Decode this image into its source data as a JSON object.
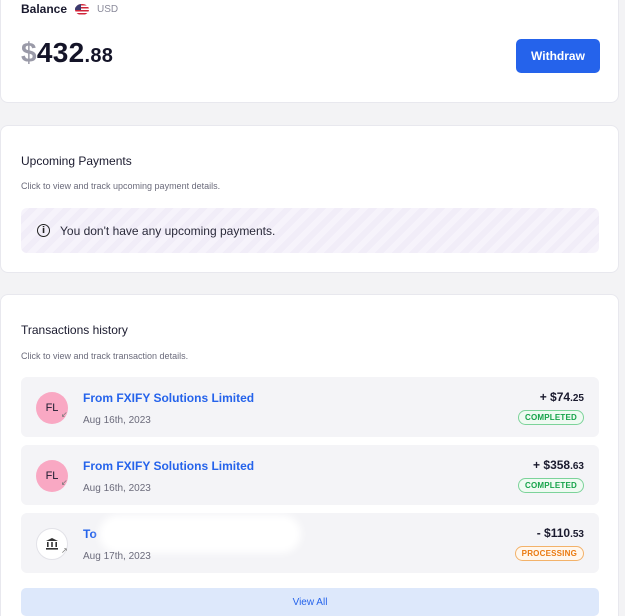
{
  "balance": {
    "label": "Balance",
    "currency": "USD",
    "currency_symbol": "$",
    "amount_whole": "432",
    "amount_cents": ".88",
    "withdraw_label": "Withdraw"
  },
  "upcoming": {
    "title": "Upcoming Payments",
    "subtitle": "Click to view and track upcoming payment details.",
    "empty_message": "You don't have any upcoming payments.",
    "info_icon": "info-icon"
  },
  "transactions": {
    "title": "Transactions history",
    "subtitle": "Click to view and track transaction details.",
    "items": [
      {
        "initials": "FL",
        "name": "From FXIFY Solutions Limited",
        "date": "Aug 16th, 2023",
        "amount_main": "+ $74",
        "amount_cents": ".25",
        "status": "COMPLETED",
        "direction_icon": "incoming-arrow-icon"
      },
      {
        "initials": "FL",
        "name": "From FXIFY Solutions Limited",
        "date": "Aug 16th, 2023",
        "amount_main": "+ $358",
        "amount_cents": ".63",
        "status": "COMPLETED",
        "direction_icon": "incoming-arrow-icon"
      },
      {
        "initials": "",
        "name": "To",
        "date": "Aug 17th, 2023",
        "amount_main": "- $110",
        "amount_cents": ".53",
        "status": "PROCESSING",
        "direction_icon": "outgoing-arrow-icon",
        "avatar_icon": "bank-icon"
      }
    ],
    "view_all_label": "View All"
  },
  "colors": {
    "accent": "#2563eb",
    "completed": "#16a34a",
    "processing": "#ea7a10",
    "avatar_pink": "#f9a8c3"
  }
}
